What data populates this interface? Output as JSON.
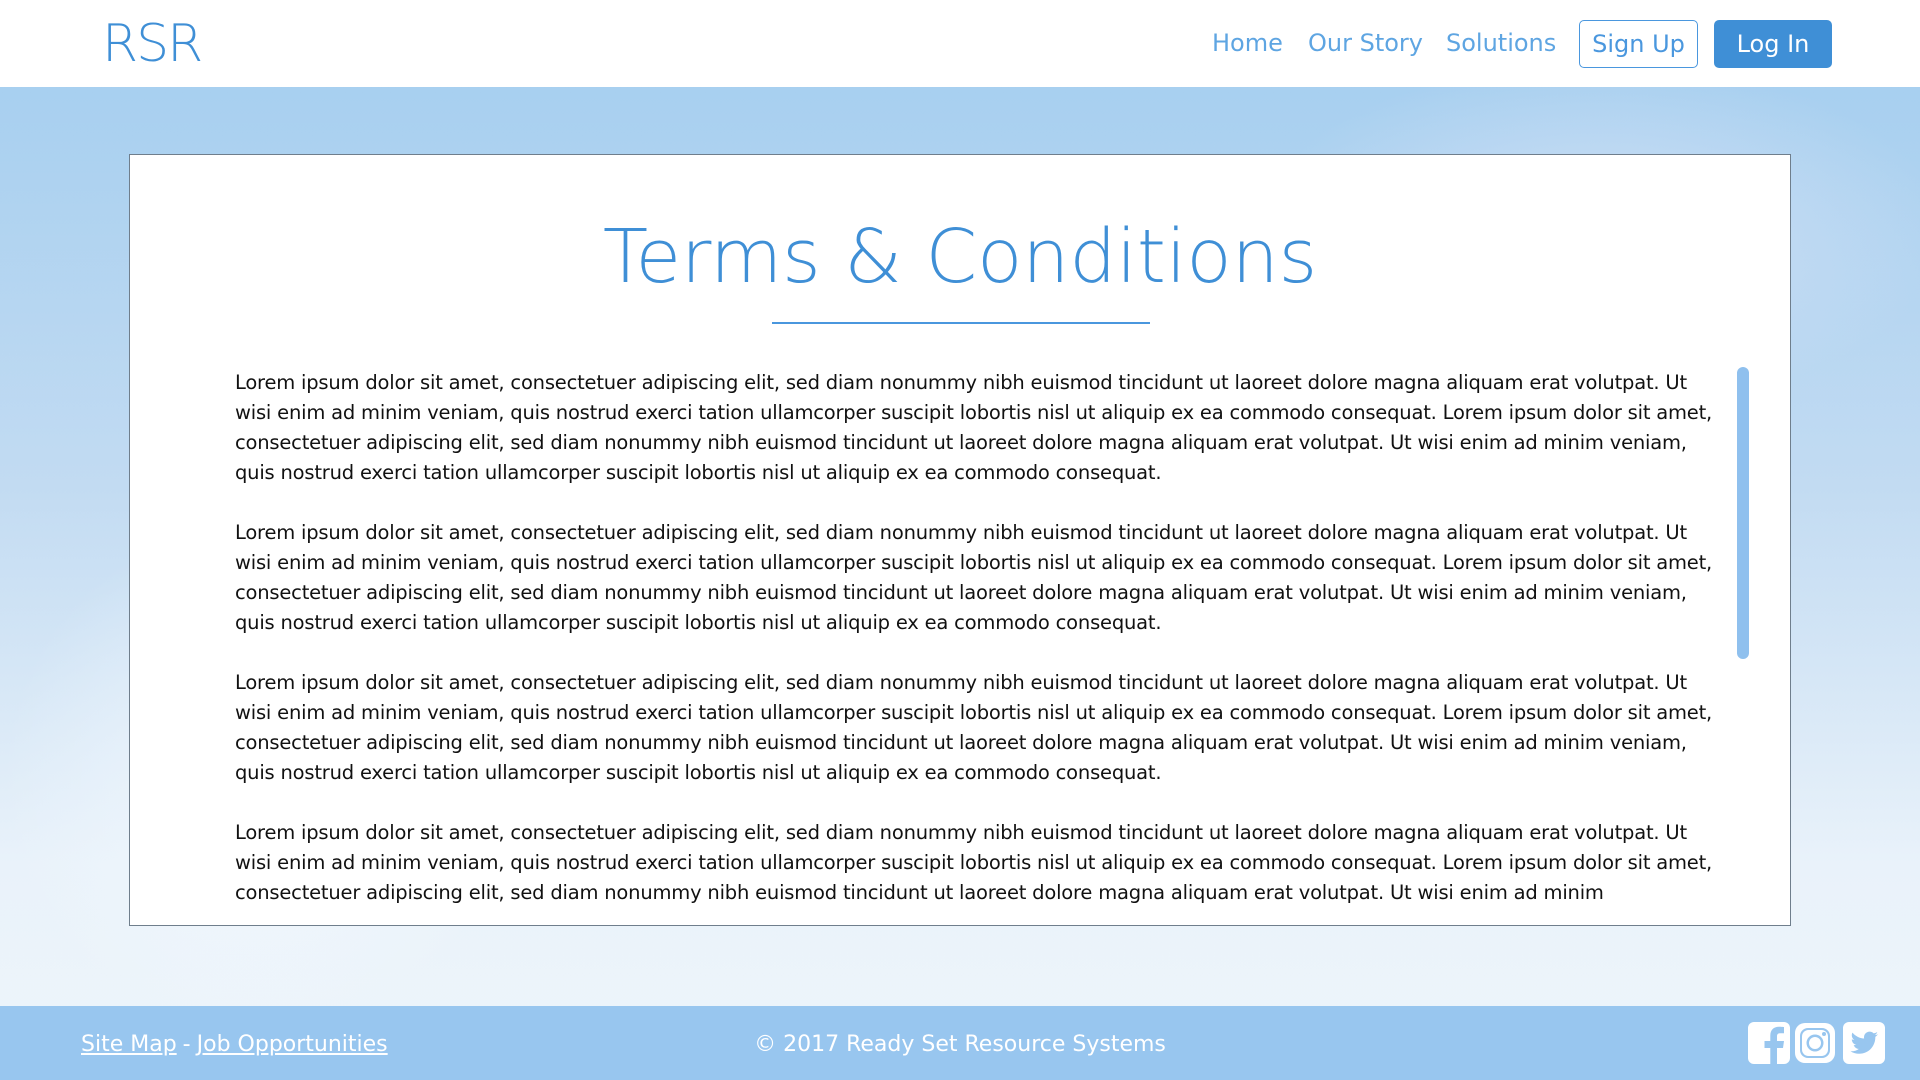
{
  "header": {
    "logo": "RSR",
    "nav": [
      {
        "label": "Home"
      },
      {
        "label": "Our Story"
      },
      {
        "label": "Solutions"
      }
    ],
    "signup_label": "Sign Up",
    "login_label": "Log In"
  },
  "main": {
    "title": "Terms & Conditions",
    "paragraphs": [
      "Lorem ipsum dolor sit amet, consectetuer adipiscing elit, sed diam nonummy nibh euismod tincidunt ut laoreet dolore magna aliquam erat volutpat. Ut wisi enim ad minim veniam, quis nostrud exerci tation ullamcorper suscipit lobortis nisl ut aliquip ex ea commodo consequat. Lorem ipsum dolor sit amet, consectetuer adipiscing elit, sed diam nonummy nibh euismod tincidunt ut laoreet dolore magna aliquam erat volutpat. Ut wisi enim ad minim veniam, quis nostrud exerci tation ullamcorper suscipit lobortis nisl ut aliquip ex ea commodo consequat.",
      "Lorem ipsum dolor sit amet, consectetuer adipiscing elit, sed diam nonummy nibh euismod tincidunt ut laoreet dolore magna aliquam erat volutpat. Ut wisi enim ad minim veniam, quis nostrud exerci tation ullamcorper suscipit lobortis nisl ut aliquip ex ea commodo consequat. Lorem ipsum dolor sit amet, consectetuer adipiscing elit, sed diam nonummy nibh euismod tincidunt ut laoreet dolore magna aliquam erat volutpat. Ut wisi enim ad minim veniam, quis nostrud exerci tation ullamcorper suscipit lobortis nisl ut aliquip ex ea commodo consequat.",
      "Lorem ipsum dolor sit amet, consectetuer adipiscing elit, sed diam nonummy nibh euismod tincidunt ut laoreet dolore magna aliquam erat volutpat. Ut wisi enim ad minim veniam, quis nostrud exerci tation ullamcorper suscipit lobortis nisl ut aliquip ex ea commodo consequat. Lorem ipsum dolor sit amet, consectetuer adipiscing elit, sed diam nonummy nibh euismod tincidunt ut laoreet dolore magna aliquam erat volutpat. Ut wisi enim ad minim veniam, quis nostrud exerci tation ullamcorper suscipit lobortis nisl ut aliquip ex ea commodo consequat.",
      "Lorem ipsum dolor sit amet, consectetuer adipiscing elit, sed diam nonummy nibh euismod tincidunt ut laoreet dolore magna aliquam erat volutpat. Ut wisi enim ad minim veniam, quis nostrud exerci tation ullamcorper suscipit lobortis nisl ut aliquip ex ea commodo consequat. Lorem ipsum dolor sit amet, consectetuer adipiscing elit, sed diam nonummy nibh euismod tincidunt ut laoreet dolore magna aliquam erat volutpat. Ut wisi enim ad minim"
    ]
  },
  "footer": {
    "site_map": "Site Map",
    "separator": "-",
    "job_opportunities": "Job Opportunities",
    "copyright": "© 2017 Ready Set Resource Systems",
    "social_icons": [
      "facebook-icon",
      "instagram-icon",
      "twitter-icon"
    ]
  },
  "colors": {
    "brand_blue": "#3f8fd6",
    "nav_blue": "#5ea5e2",
    "footer_bg": "#98c6ef",
    "scrollbar": "#8fc0ee"
  }
}
